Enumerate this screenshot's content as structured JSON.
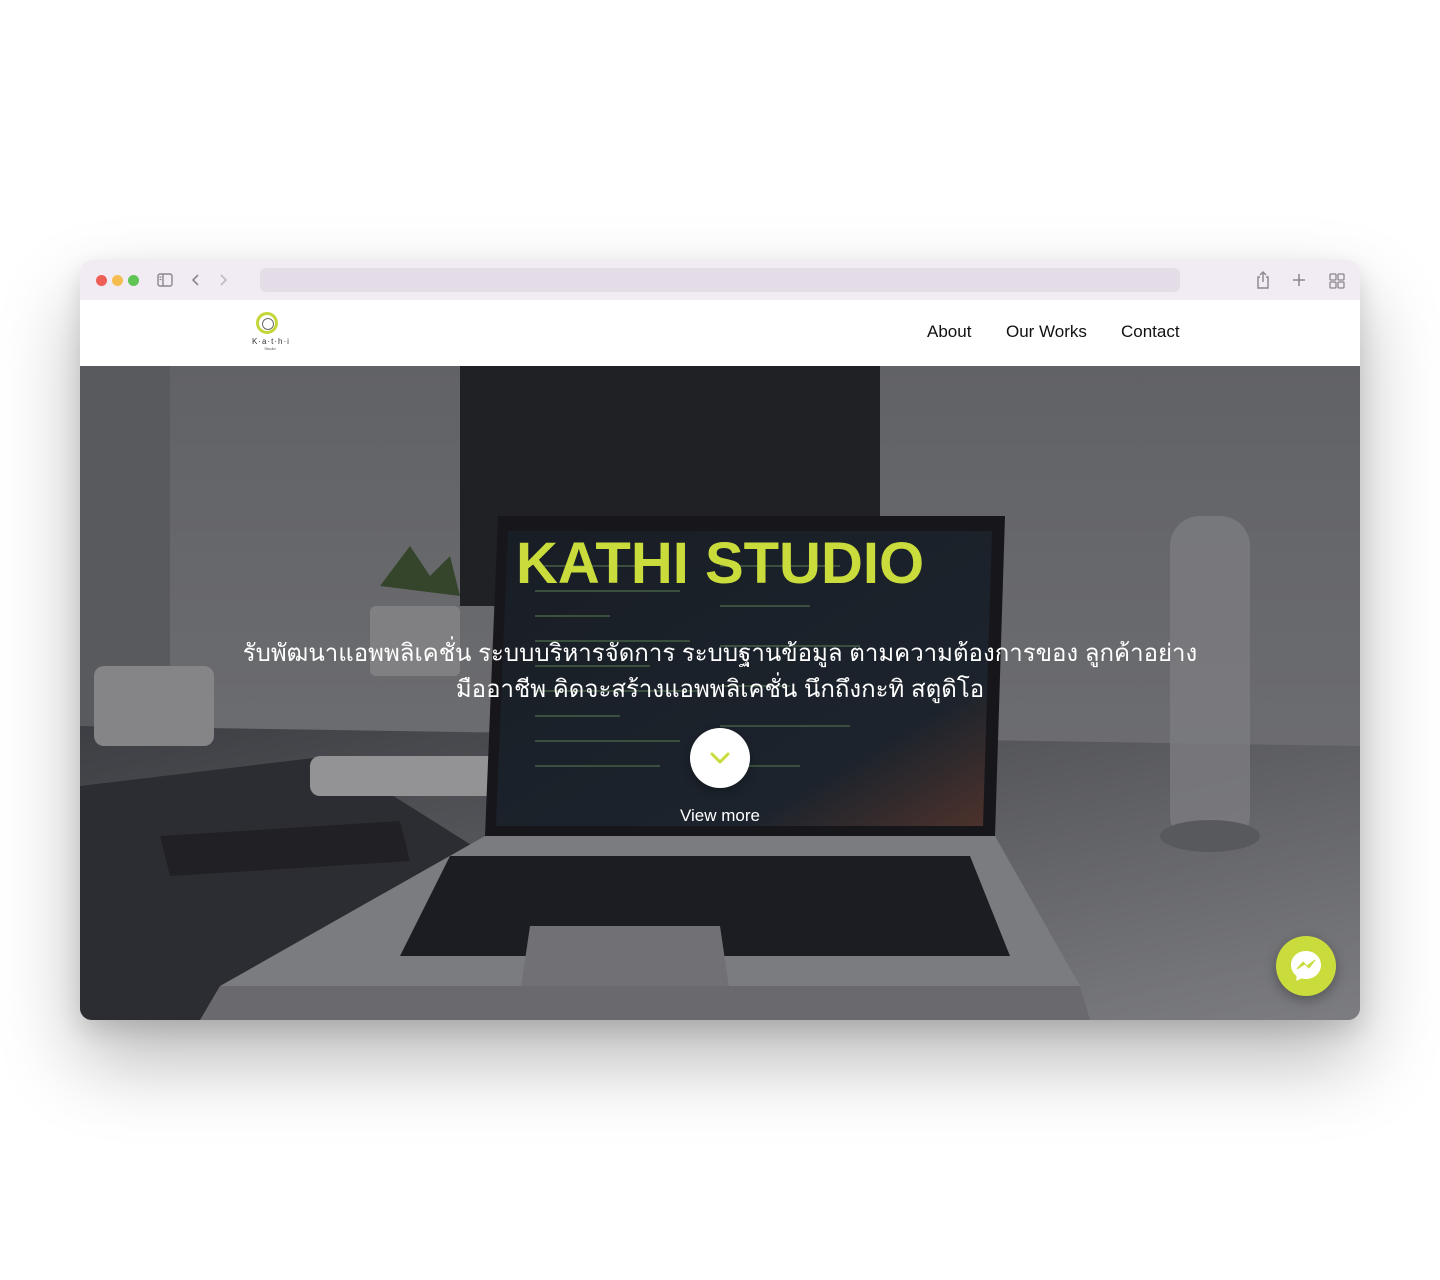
{
  "browser": {
    "traffic_lights": [
      "#ee5f57",
      "#f5bd4f",
      "#5ec454"
    ],
    "icons": [
      "sidebar-icon",
      "back-icon",
      "forward-icon",
      "share-icon",
      "new-tab-icon",
      "tab-overview-icon"
    ]
  },
  "site": {
    "logo_text": "K·a·t·h·i",
    "logo_subtext": "Studio",
    "nav": {
      "about": "About",
      "our_works": "Our Works",
      "contact": "Contact"
    }
  },
  "hero": {
    "title": "KATHI STUDIO",
    "description": "รับพัฒนาแอพพลิเคชั่น ระบบบริหารจัดการ ระบบฐานข้อมูล ตามความต้องการของ ลูกค้าอย่างมืออาชีพ คิดจะสร้างแอพพลิเคชั่น นึกถึงกะทิ สตูดิโอ",
    "view_more": "View more",
    "accent_color": "#c9dc3b"
  },
  "widgets": {
    "messenger_icon": "messenger-icon"
  }
}
